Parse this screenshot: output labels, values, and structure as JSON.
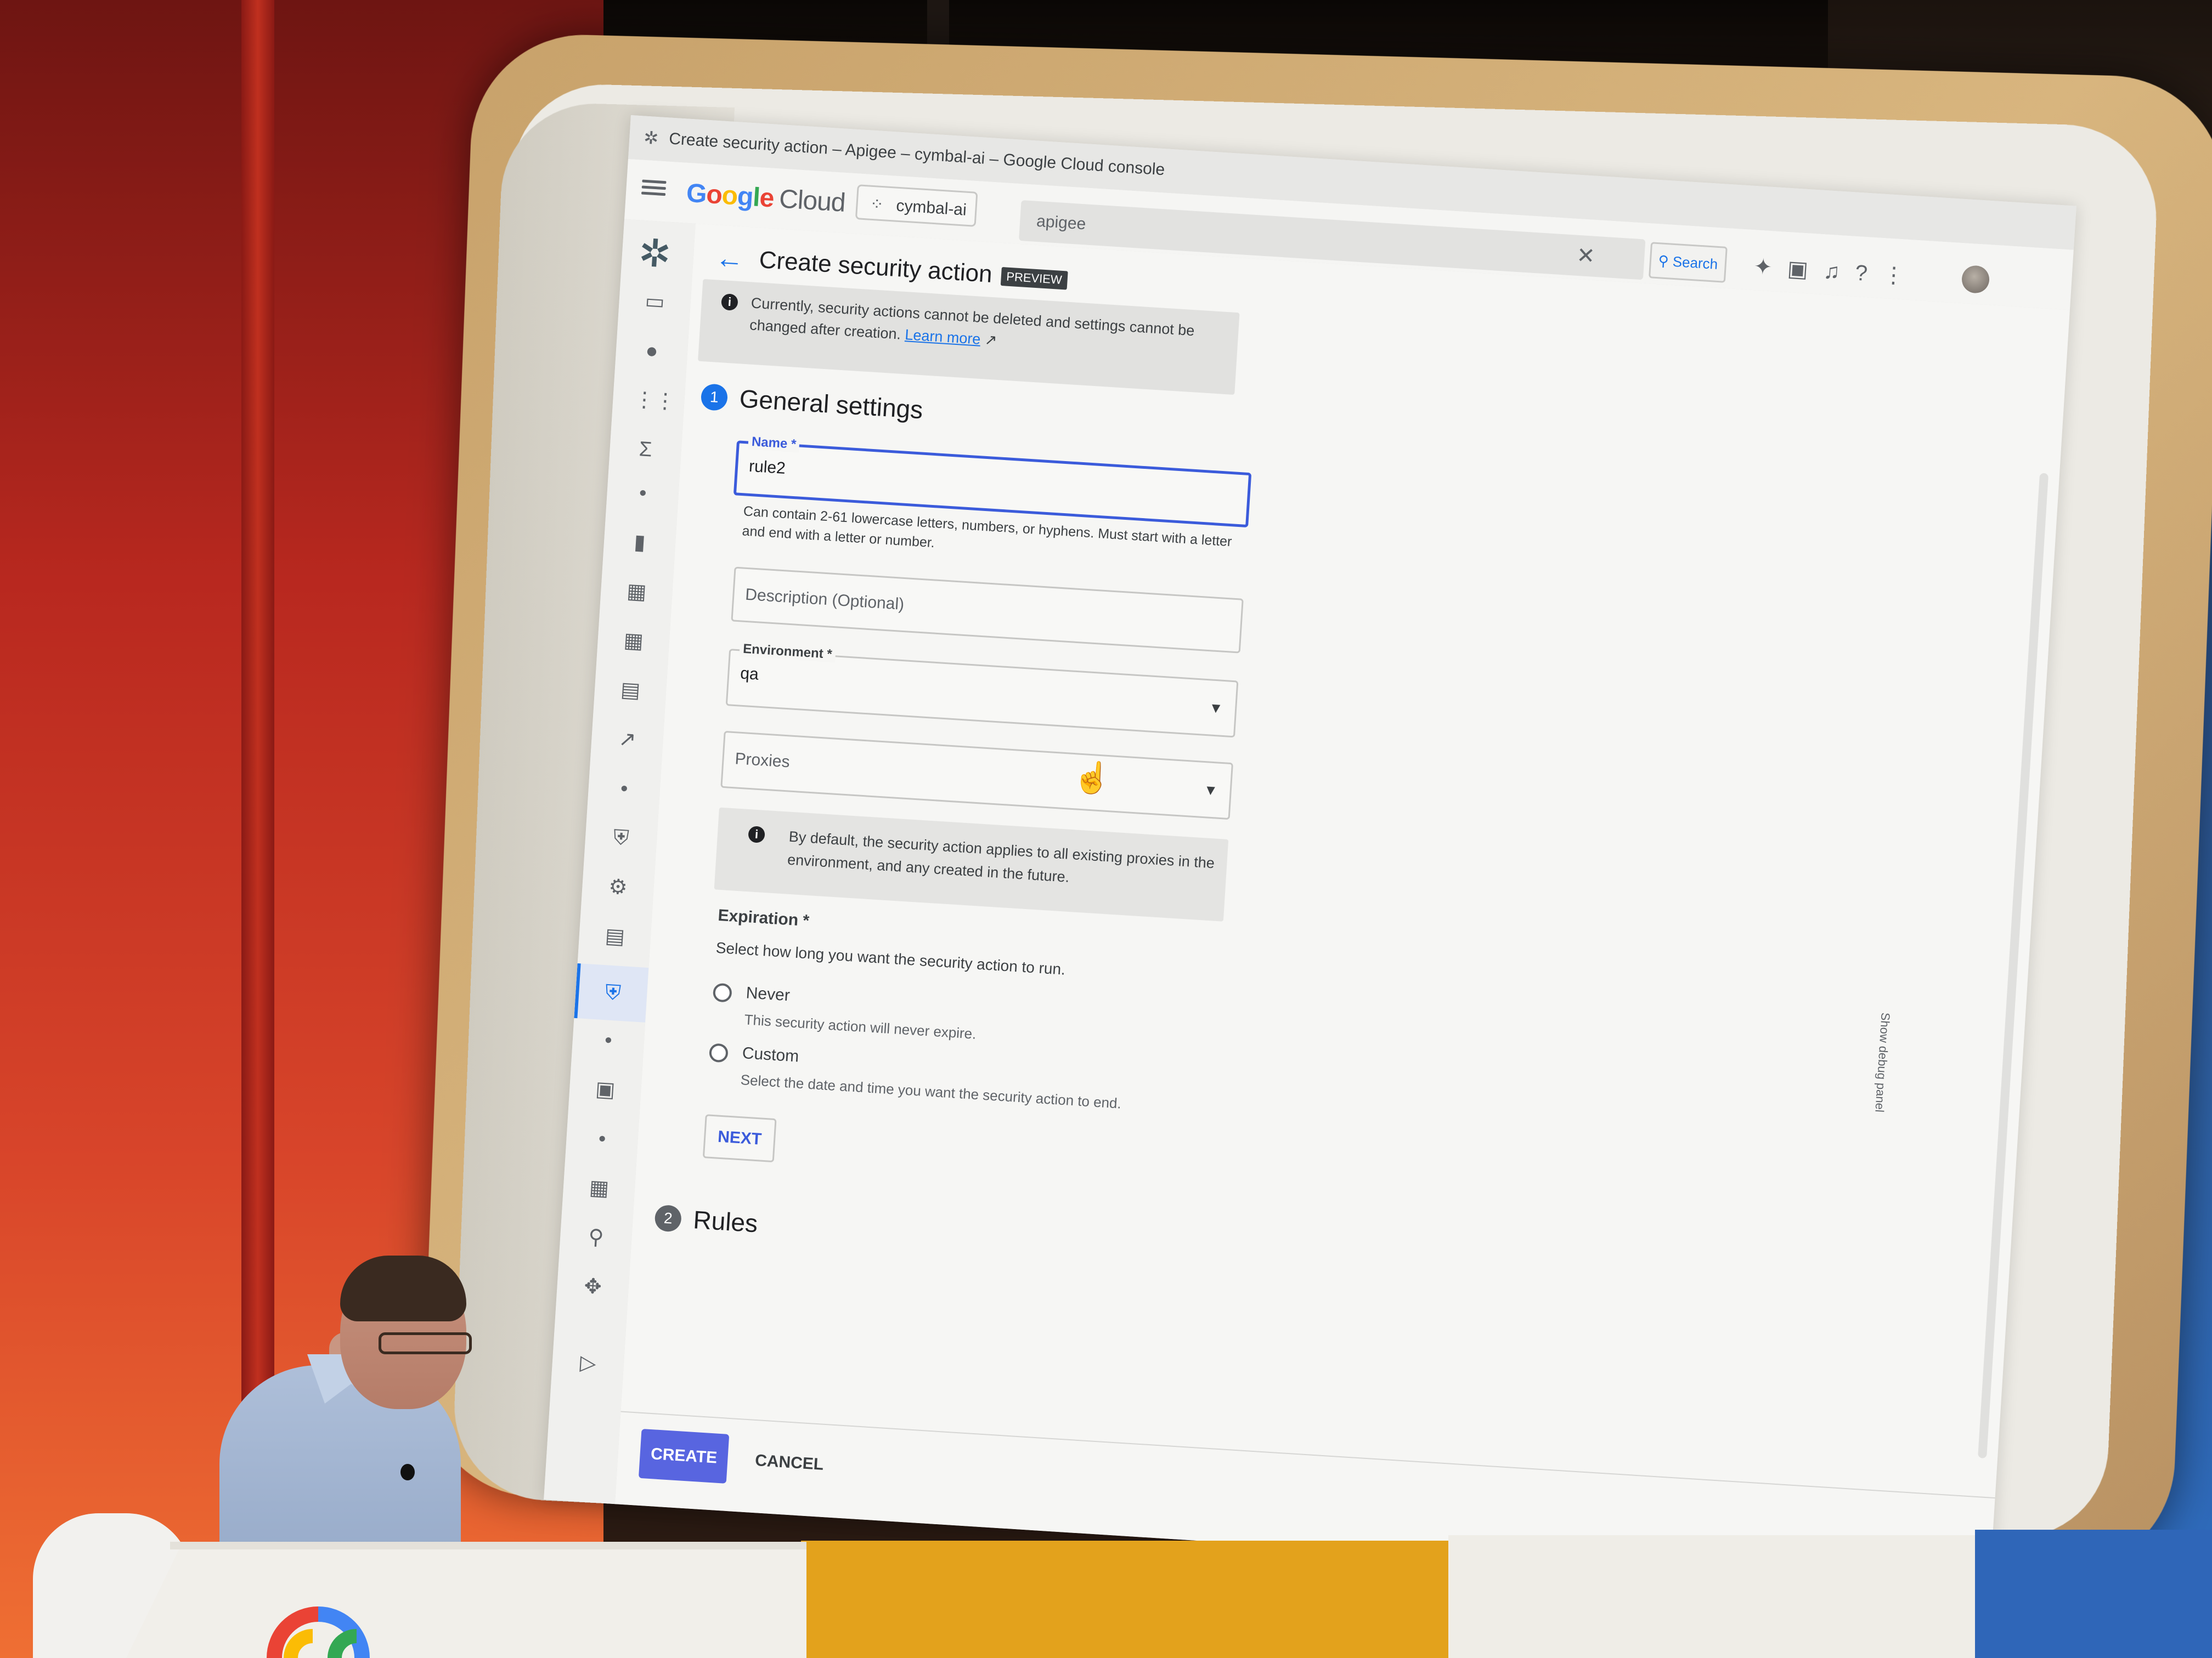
{
  "browser": {
    "tab_title": "Create security action – Apigee – cymbal-ai – Google Cloud console"
  },
  "topbar": {
    "logo_google": "Google",
    "logo_cloud": "Cloud",
    "project": "cymbal-ai",
    "search_value": "apigee",
    "search_button": "Search"
  },
  "page": {
    "title": "Create security action",
    "badge": "PREVIEW",
    "banner_text": "Currently, security actions cannot be deleted and settings cannot be changed after creation.",
    "banner_link": "Learn more"
  },
  "step1": {
    "number": "1",
    "title": "General settings",
    "name_label": "Name *",
    "name_value": "rule2",
    "name_hint": "Can contain 2-61 lowercase letters, numbers, or hyphens. Must start with a letter and end with a letter or number.",
    "description_placeholder": "Description (Optional)",
    "environment_label": "Environment *",
    "environment_value": "qa",
    "proxies_placeholder": "Proxies",
    "proxies_info": "By default, the security action applies to all existing proxies in the environment, and any created in the future.",
    "expiration_label": "Expiration *",
    "expiration_desc": "Select how long you want the security action to run.",
    "option_never": "Never",
    "option_never_desc": "This security action will never expire.",
    "option_custom": "Custom",
    "option_custom_desc": "Select the date and time you want the security action to end.",
    "next_button": "NEXT"
  },
  "step2": {
    "number": "2",
    "title": "Rules"
  },
  "footer": {
    "create_button": "CREATE",
    "cancel_button": "CANCEL"
  },
  "side_panel_label": "Show debug panel",
  "colors": {
    "accent": "#1a73e8",
    "focus": "#3b5bdb",
    "create_button": "#5865e0"
  }
}
